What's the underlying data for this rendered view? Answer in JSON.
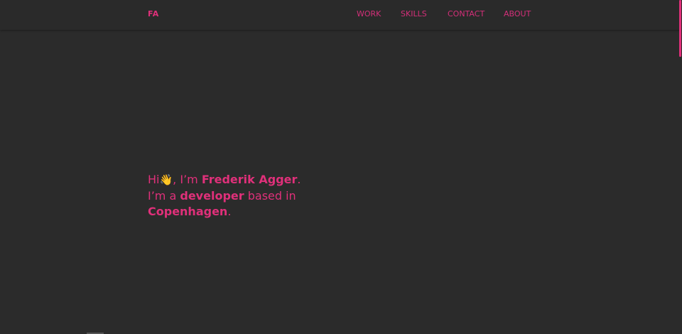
{
  "nav": {
    "logo": "FA",
    "links": [
      "WORK",
      "SKILLS",
      "CONTACT",
      "ABOUT"
    ]
  },
  "hero": {
    "line1": {
      "greeting": "Hi",
      "wave_icon": "👋",
      "intro": ", I’m ",
      "name": "Frederik Agger",
      "period": "."
    },
    "line2": {
      "prefix": "I’m a ",
      "role": "developer",
      "suffix": " based in"
    },
    "line3": {
      "city": "Copenhagen",
      "period": "."
    }
  },
  "colors": {
    "accent": "#e0307a",
    "background": "#2b2b2b"
  },
  "icons": {
    "wave": "waving-hand-icon"
  }
}
